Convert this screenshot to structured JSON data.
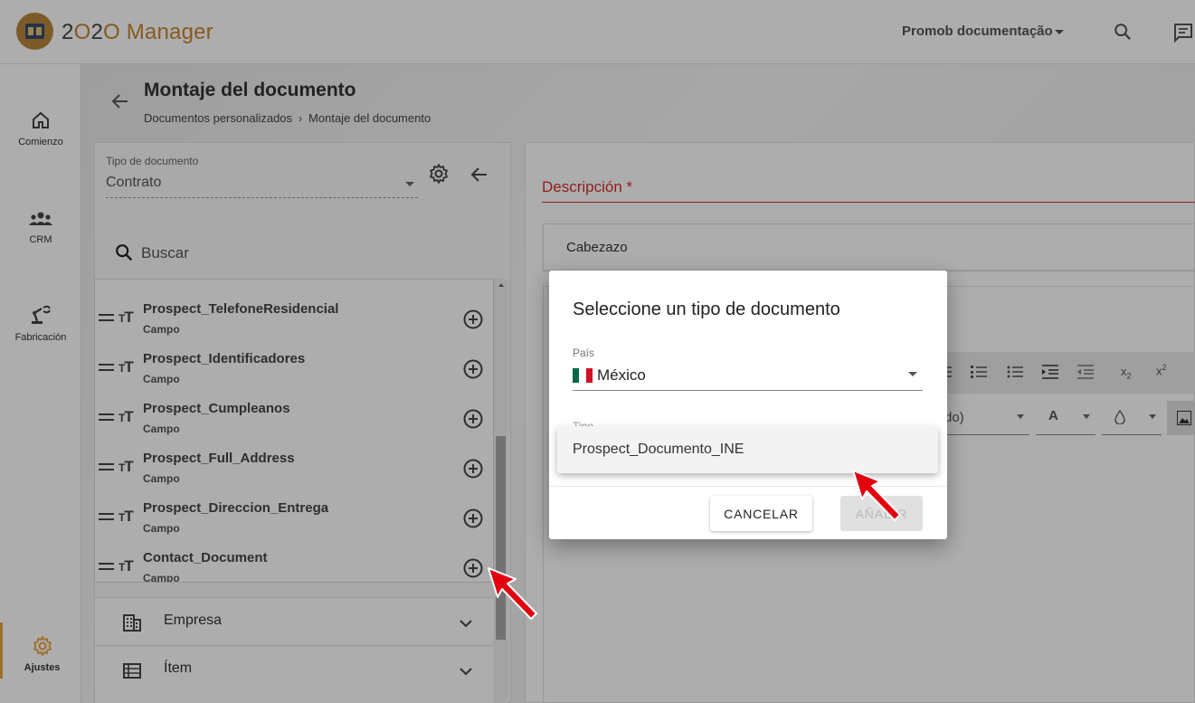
{
  "app": {
    "logo_text_a": "2",
    "logo_text_b": "O",
    "logo_text_c": "2",
    "logo_text_d": "O",
    "logo_text_e": " Manager",
    "account_name": "Promob documentação"
  },
  "sidebar": {
    "items": [
      {
        "label": "Comienzo",
        "icon": "home-icon"
      },
      {
        "label": "CRM",
        "icon": "people-icon"
      },
      {
        "label": "Fabricación",
        "icon": "factory-arm-icon"
      },
      {
        "label": "Ajustes",
        "icon": "gear-icon",
        "active": true
      }
    ]
  },
  "header": {
    "title": "Montaje del documento",
    "breadcrumb": [
      "Documentos personalizados",
      "Montaje del documento"
    ]
  },
  "left_panel": {
    "tipo_label": "Tipo de documento",
    "tipo_value": "Contrato",
    "search_placeholder": "Buscar",
    "fields": [
      {
        "name": "Prospect_TelefoneResidencial",
        "type": "Campo"
      },
      {
        "name": "Prospect_Identificadores",
        "type": "Campo"
      },
      {
        "name": "Prospect_Cumpleanos",
        "type": "Campo"
      },
      {
        "name": "Prospect_Full_Address",
        "type": "Campo"
      },
      {
        "name": "Prospect_Direccion_Entrega",
        "type": "Campo"
      },
      {
        "name": "Contact_Document",
        "type": "Campo"
      }
    ],
    "groups": [
      {
        "label": "Empresa",
        "icon": "building-icon"
      },
      {
        "label": "Ítem",
        "icon": "list-icon"
      }
    ]
  },
  "right_panel": {
    "description_label": "Descripción *",
    "section_header": "Cabezazo",
    "font_select_partial": "do)",
    "font_color_label": "A"
  },
  "dialog": {
    "title": "Seleccione un tipo de documento",
    "pais_label": "País",
    "pais_value": "México",
    "tipo_label": "Tipo",
    "dropdown_options": [
      "Prospect_Documento_INE"
    ],
    "cancel_label": "CANCELAR",
    "add_label": "AÑADIR"
  },
  "colors": {
    "accent": "#c8852f",
    "error": "#d32f2f",
    "active_nav": "#e8a33b",
    "cursor": "#e3000f"
  }
}
